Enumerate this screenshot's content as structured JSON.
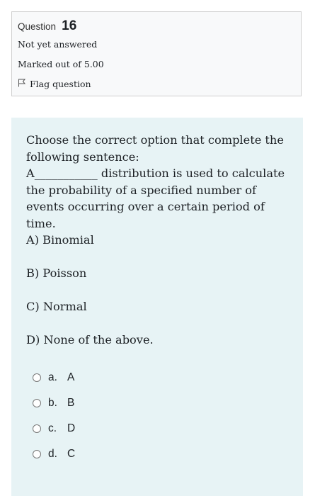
{
  "info": {
    "question_label": "Question",
    "question_number": "16",
    "state": "Not yet answered",
    "grade": "Marked out of 5.00",
    "flag_label": "Flag question"
  },
  "question": {
    "line1": "Choose the correct option that complete the following sentence:",
    "line2": "A___________ distribution is used to calculate the probability of a specified number of events occurring over a certain period of time.",
    "options": [
      "A) Binomial",
      "B) Poisson",
      "C) Normal",
      "D) None of the above."
    ]
  },
  "answers": [
    {
      "letter": "a.",
      "value": "A"
    },
    {
      "letter": "b.",
      "value": "B"
    },
    {
      "letter": "c.",
      "value": "D"
    },
    {
      "letter": "d.",
      "value": "C"
    }
  ]
}
